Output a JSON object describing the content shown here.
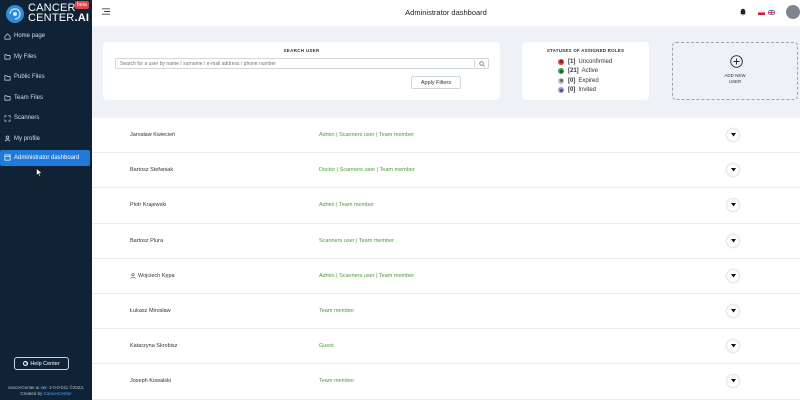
{
  "app": {
    "logo_line1": "CANCER",
    "logo_line2": "CENTER",
    "logo_ai": ".AI",
    "beta_badge": "beta"
  },
  "sidebar": {
    "items": [
      {
        "label": "Home page",
        "icon": "home-icon"
      },
      {
        "label": "My Files",
        "icon": "folder-icon"
      },
      {
        "label": "Public Files",
        "icon": "folder-icon"
      },
      {
        "label": "Team Files",
        "icon": "folder-icon"
      },
      {
        "label": "Scanners",
        "icon": "scanner-icon"
      },
      {
        "label": "My profile",
        "icon": "user-icon"
      },
      {
        "label": "Administrator dashboard",
        "icon": "dashboard-icon",
        "active": true
      }
    ],
    "help_label": "Help Center",
    "footer_line1": "cancerCenter.ai ver. 2-0-0-b11 ©2023.",
    "footer_created": "Created by",
    "footer_link": "CancerCenter"
  },
  "header": {
    "title": "Administrator dashboard"
  },
  "search": {
    "title": "SEARCH USER",
    "placeholder": "Search for a user by name / surname / e-mail address / phone number",
    "apply_label": "Apply Filters"
  },
  "statuses": {
    "title": "STATUSES OF ASSIGNED ROLES",
    "items": [
      {
        "count": "[1]",
        "label": "Unconfirmed",
        "color": "#e03c3c"
      },
      {
        "count": "[21]",
        "label": "Active",
        "color": "#2fa84f"
      },
      {
        "count": "[0]",
        "label": "Expired",
        "color": "#b9bec4"
      },
      {
        "count": "[0]",
        "label": "Invited",
        "color": "#a98be0"
      }
    ]
  },
  "add_user": {
    "line1": "ADD NEW",
    "line2": "USER"
  },
  "users": [
    {
      "name": "Jarosław Kwiecień",
      "roles": "Admin | Scanners user | Team member"
    },
    {
      "name": "Bartosz Stefaniak",
      "roles": "Doctor | Scanners user | Team member"
    },
    {
      "name": "Piotr Krajewski",
      "roles": "Admin | Team member"
    },
    {
      "name": "Bartosz Plura",
      "roles": "Scanners user | Team member"
    },
    {
      "name": "Wojciech Kępa",
      "roles": "Admin | Scanners user | Team member",
      "current_user": true
    },
    {
      "name": "Łukasz Mirosław",
      "roles": "Team member"
    },
    {
      "name": "Katarzyna Skrobisz",
      "roles": "Guest"
    },
    {
      "name": "Joseph Kowalski",
      "roles": "Team member"
    }
  ],
  "colors": {
    "sidebar_bg": "#0f2236",
    "accent": "#1f7adb",
    "role_text": "#4a9a3a"
  }
}
